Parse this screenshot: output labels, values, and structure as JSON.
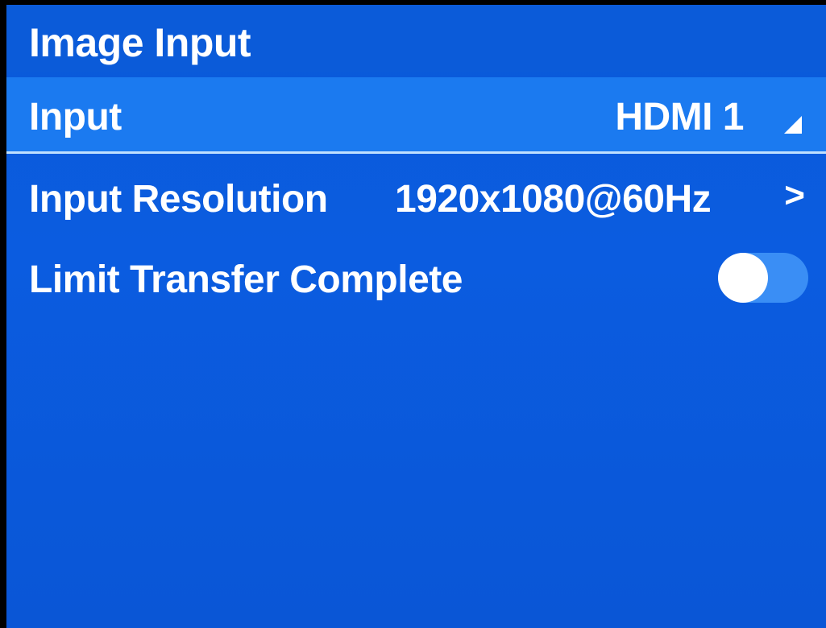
{
  "header": {
    "title": "Image Input"
  },
  "settings": {
    "input": {
      "label": "Input",
      "value": "HDMI 1"
    },
    "input_resolution": {
      "label": "Input Resolution",
      "value": "1920x1080@60Hz",
      "icon": "chevron-right-icon"
    },
    "limit_transfer_complete": {
      "label": "Limit Transfer Complete",
      "state": "off"
    }
  },
  "colors": {
    "background": "#0a5ad8",
    "selected_row": "#1b7af0",
    "toggle_track": "#3a8ef5",
    "text": "#ffffff"
  }
}
